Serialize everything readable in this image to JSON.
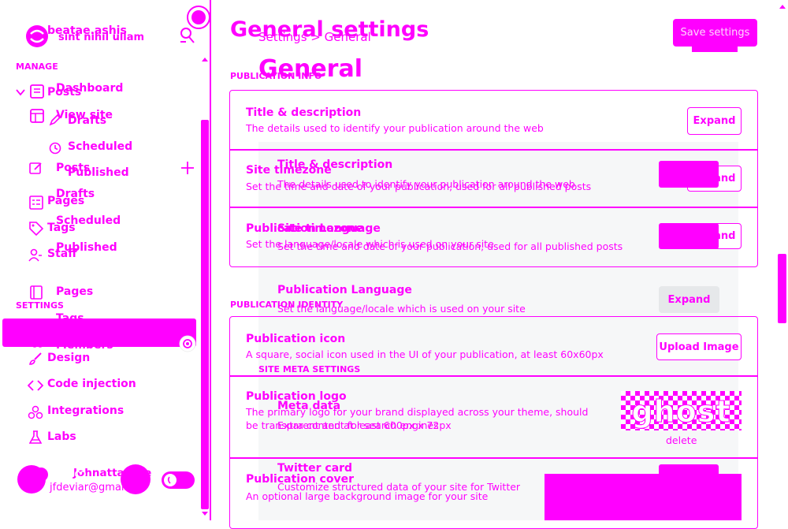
{
  "sidebar": {
    "site_name": "beatae.ashis",
    "site_subtitle": "sint nihil ullam",
    "manage_heading": "MANAGE",
    "settings_heading": "SETTINGS",
    "items": [
      {
        "label": "Dashboard"
      },
      {
        "label": "View site"
      },
      {
        "label": "Posts"
      },
      {
        "label": "Drafts"
      },
      {
        "label": "Scheduled"
      },
      {
        "label": "Published"
      },
      {
        "label": "Posts"
      },
      {
        "label": "Drafts"
      },
      {
        "label": "Scheduled"
      },
      {
        "label": "Published"
      },
      {
        "label": "Pages"
      },
      {
        "label": "Tags"
      },
      {
        "label": "Staff"
      },
      {
        "label": "Pages"
      },
      {
        "label": "Tags"
      },
      {
        "label": "Members"
      },
      {
        "label": "Design"
      },
      {
        "label": "Code injection"
      },
      {
        "label": "Integrations"
      },
      {
        "label": "Labs"
      }
    ],
    "user_name": "Johnattan De",
    "user_email": "jfdeviar@gmail.c"
  },
  "header": {
    "page_title": "General settings",
    "breadcrumb": "Settings > General",
    "section_title": "General",
    "save_button": "Save settings"
  },
  "publication_info": {
    "heading": "PUBLICATION INFO",
    "rows": [
      {
        "title": "Title & description",
        "description": "The details used to identify your publication around the web",
        "button": "Expand"
      },
      {
        "title": "Site timezone",
        "description": "Set the time and date of your publication, used for all published posts",
        "button": "Expand"
      },
      {
        "title": "Publication Language",
        "description": "Set the language/locale which is used on your site",
        "button": "Expand"
      }
    ]
  },
  "overlay": {
    "rows": [
      {
        "title": "Title & description",
        "description": "The details used to identify your publication around the web"
      },
      {
        "title": "Site timezone",
        "description": "Set the time and date of your publication, used for all published posts"
      },
      {
        "title": "Publication Language",
        "description": "Set the language/locale which is used on your site",
        "button": "Expand"
      }
    ],
    "meta_heading": "SITE META SETTINGS",
    "meta_title": "Meta data",
    "meta_description": "Extra content for search engines",
    "twitter_title": "Twitter card",
    "twitter_description": "Customize structured data of your site for Twitter"
  },
  "publication_identity": {
    "heading": "PUBLICATION IDENTITY",
    "icon_title": "Publication icon",
    "icon_description": "A square, social icon used in the UI of your publication, at least 60x60px",
    "upload_button": "Upload Image",
    "logo_title": "Publication logo",
    "logo_description_1": "The primary logo for your brand displayed across your theme, should",
    "logo_description_2": "be transparent and at least 600px x 72px",
    "logo_text": "ghost",
    "logo_delete": "delete",
    "cover_title": "Publication cover",
    "cover_description": "An optional large background image for your site"
  },
  "colors": {
    "accent": "#ff00ff",
    "overlay_panel": "#f6f7f8",
    "button_gray": "#e6e8ea"
  }
}
